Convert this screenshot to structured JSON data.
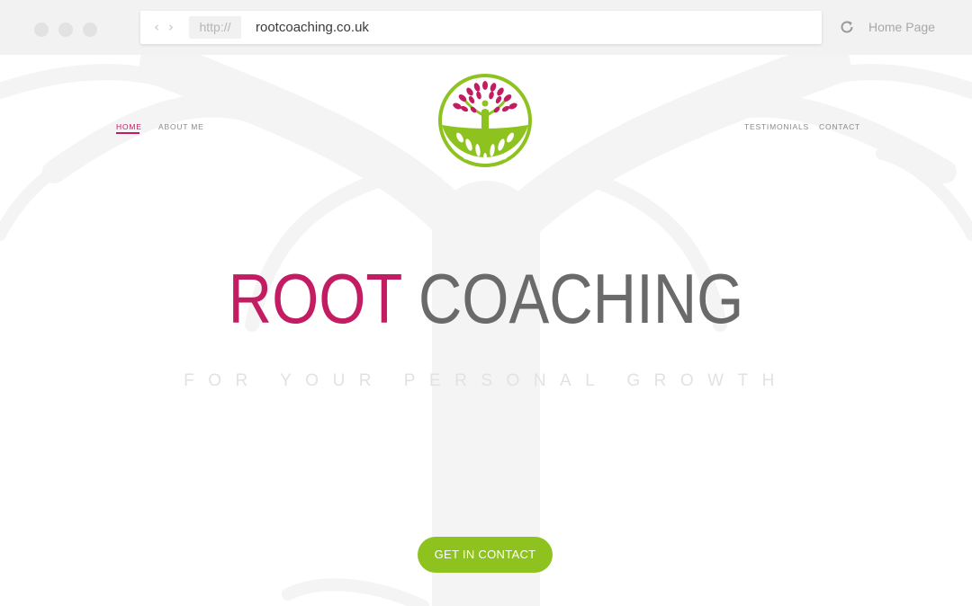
{
  "browser": {
    "protocol": "http://",
    "url": "rootcoaching.co.uk",
    "home_label": "Home Page"
  },
  "nav": {
    "left": [
      "HOME",
      "ABOUT ME"
    ],
    "right": [
      "TESTIMONIALS",
      "CONTACT"
    ],
    "active": "HOME"
  },
  "hero": {
    "title_word1": "ROOT",
    "title_word2": "COACHING",
    "tagline": "FOR YOUR PERSONAL GROWTH",
    "cta_label": "GET IN CONTACT"
  },
  "colors": {
    "brand_pink": "#c21d63",
    "brand_green": "#8dc21f",
    "title_gray": "#6a6a6a"
  }
}
